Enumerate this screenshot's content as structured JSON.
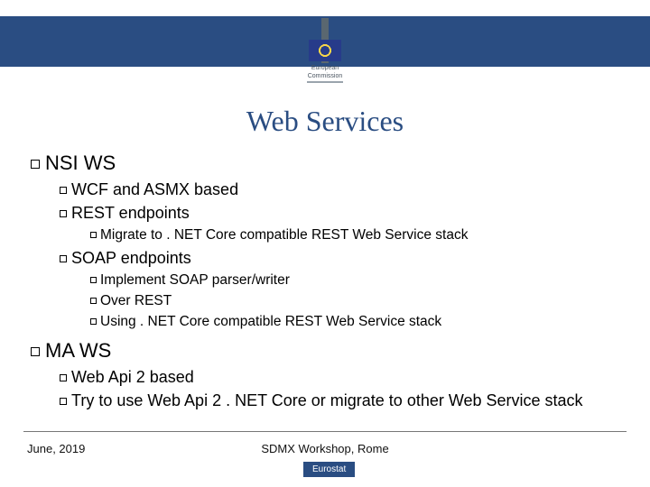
{
  "logo": {
    "line1": "European",
    "line2": "Commission"
  },
  "title": "Web Services",
  "sections": [
    {
      "label": "NSI WS",
      "items": [
        {
          "label": "WCF and ASMX based"
        },
        {
          "label": "REST endpoints",
          "sub": [
            {
              "label": "Migrate to . NET Core compatible REST Web Service stack"
            }
          ]
        },
        {
          "label": "SOAP endpoints",
          "sub": [
            {
              "label": "Implement SOAP parser/writer"
            },
            {
              "label": "Over REST"
            },
            {
              "label": "Using . NET Core compatible REST Web Service stack"
            }
          ]
        }
      ]
    },
    {
      "label": "MA WS",
      "items": [
        {
          "label": "Web Api 2 based"
        },
        {
          "label": "Try to use Web Api 2 . NET Core or migrate to other Web Service stack"
        }
      ]
    }
  ],
  "footer": {
    "left": "June, 2019",
    "center": "SDMX Workshop, Rome",
    "badge": "Eurostat"
  }
}
